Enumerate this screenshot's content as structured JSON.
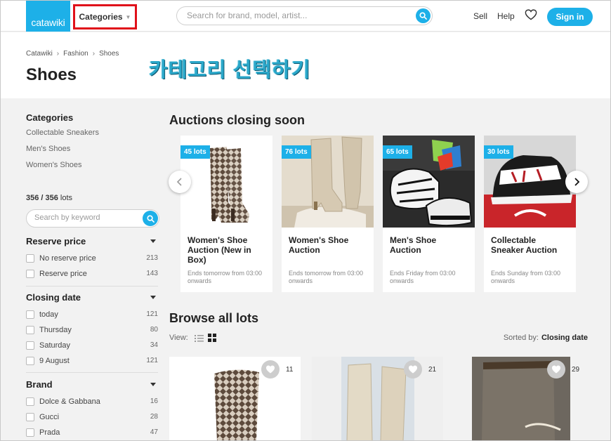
{
  "header": {
    "logo": "catawiki",
    "categories_label": "Categories",
    "search_placeholder": "Search for brand, model, artist...",
    "sell": "Sell",
    "help": "Help",
    "sign_in": "Sign in"
  },
  "breadcrumb": [
    "Catawiki",
    "Fashion",
    "Shoes"
  ],
  "page_title": "Shoes",
  "annotation": "카테고리 선택하기",
  "sidebar": {
    "categories_heading": "Categories",
    "categories": [
      "Collectable Sneakers",
      "Men's Shoes",
      "Women's Shoes"
    ],
    "lots_count_bold": "356 / 356",
    "lots_count_suffix": " lots",
    "keyword_placeholder": "Search by keyword",
    "filters": [
      {
        "heading": "Reserve price",
        "options": [
          {
            "label": "No reserve price",
            "count": "213"
          },
          {
            "label": "Reserve price",
            "count": "143"
          }
        ]
      },
      {
        "heading": "Closing date",
        "options": [
          {
            "label": "today",
            "count": "121"
          },
          {
            "label": "Thursday",
            "count": "80"
          },
          {
            "label": "Saturday",
            "count": "34"
          },
          {
            "label": "9 August",
            "count": "121"
          }
        ]
      },
      {
        "heading": "Brand",
        "options": [
          {
            "label": "Dolce & Gabbana",
            "count": "16"
          },
          {
            "label": "Gucci",
            "count": "28"
          },
          {
            "label": "Prada",
            "count": "47"
          }
        ]
      }
    ]
  },
  "auctions": {
    "heading": "Auctions closing soon",
    "cards": [
      {
        "badge": "45 lots",
        "title": "Women's Shoe Auction (New in Box)",
        "subtitle": "Ends tomorrow from 03:00 onwards"
      },
      {
        "badge": "76 lots",
        "title": "Women's Shoe Auction",
        "subtitle": "Ends tomorrow from 03:00 onwards"
      },
      {
        "badge": "65 lots",
        "title": "Men's Shoe Auction",
        "subtitle": "Ends Friday from 03:00 onwards"
      },
      {
        "badge": "30 lots",
        "title": "Collectable Sneaker Auction",
        "subtitle": "Ends Sunday from 03:00 onwards"
      }
    ]
  },
  "browse": {
    "heading": "Browse all lots",
    "view_label": "View:",
    "sorted_label": "Sorted by:",
    "sorted_value": "Closing date",
    "lots": [
      {
        "favorites": "11"
      },
      {
        "favorites": "21"
      },
      {
        "favorites": "29"
      }
    ]
  },
  "colors": {
    "brand": "#1db0e8",
    "highlight": "#e0101a",
    "annotation": "#2aa7c9"
  }
}
